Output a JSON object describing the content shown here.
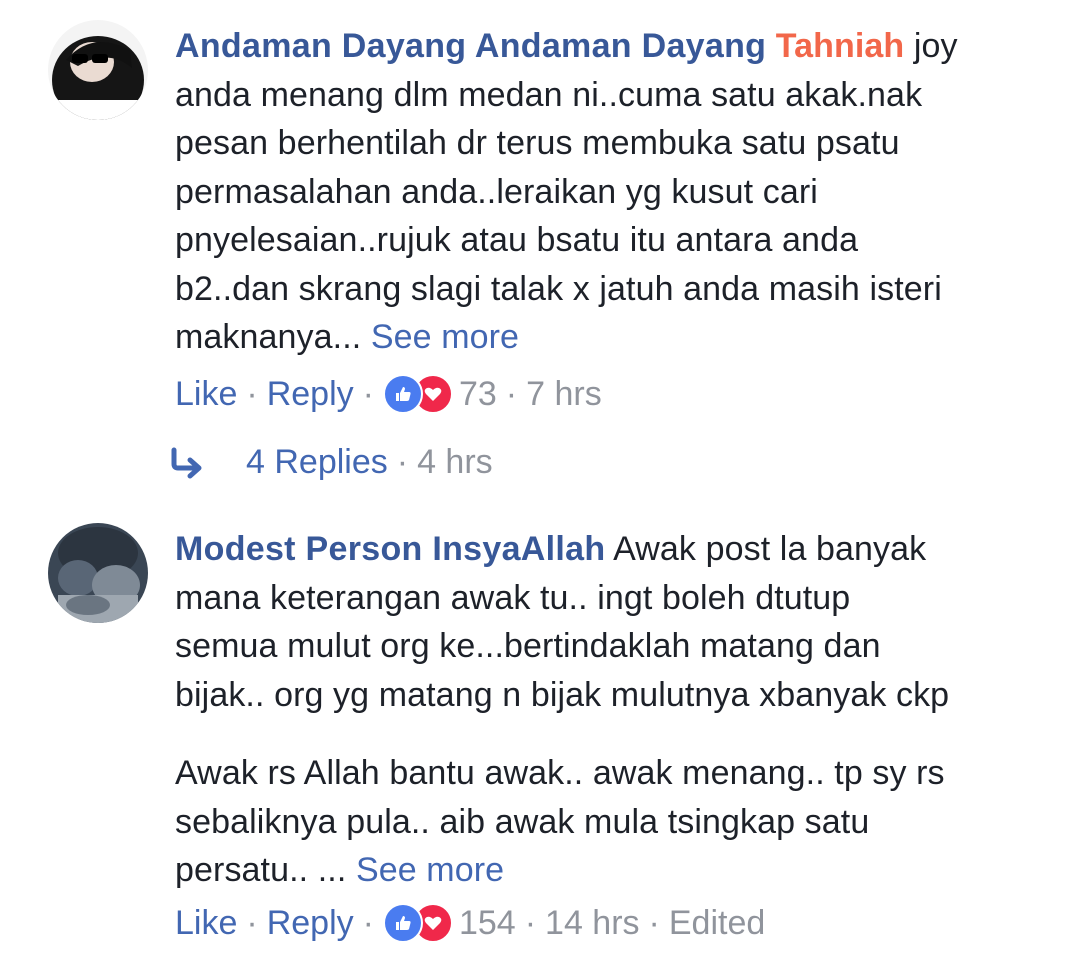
{
  "comments": [
    {
      "author": "Andaman Dayang Andaman Dayang",
      "mention": "Tahniah",
      "text_lines": [
        " joy",
        "anda menang dlm medan ni..cuma satu akak.nak",
        "pesan berhentilah dr terus membuka satu psatu",
        "permasalahan anda..leraikan yg kusut cari",
        "pnyelesaian..rujuk atau bsatu itu antara anda",
        "b2..dan skrang slagi talak x jatuh anda masih isteri",
        "maknanya... "
      ],
      "see_more": "See more",
      "like_label": "Like",
      "reply_label": "Reply",
      "reaction_count": "73",
      "time": "7 hrs",
      "replies_label": "4 Replies",
      "replies_time": "4 hrs"
    },
    {
      "author": "Modest Person InsyaAllah",
      "text_lines": [
        " Awak post la banyak",
        "mana keterangan awak tu.. ingt boleh dtutup",
        "semua mulut org ke...bertindaklah matang dan",
        "bijak.. org yg matang n bijak mulutnya xbanyak ckp"
      ],
      "para2_lines": [
        "Awak rs Allah bantu awak.. awak menang.. tp sy rs",
        "sebaliknya pula.. aib awak mula tsingkap satu",
        "persatu.. ... "
      ],
      "see_more": "See more",
      "like_label": "Like",
      "reply_label": "Reply",
      "reaction_count": "154",
      "time": "14 hrs",
      "edited": "Edited"
    }
  ],
  "colors": {
    "author": "#385898",
    "link": "#4267b2",
    "mention": "#f2674a",
    "meta": "#90949c",
    "text": "#1d2129",
    "like_reaction": "#4a7cf0",
    "love_reaction": "#f0284a"
  },
  "icons": [
    "like-reaction-icon",
    "love-reaction-icon",
    "reply-arrow-icon"
  ]
}
